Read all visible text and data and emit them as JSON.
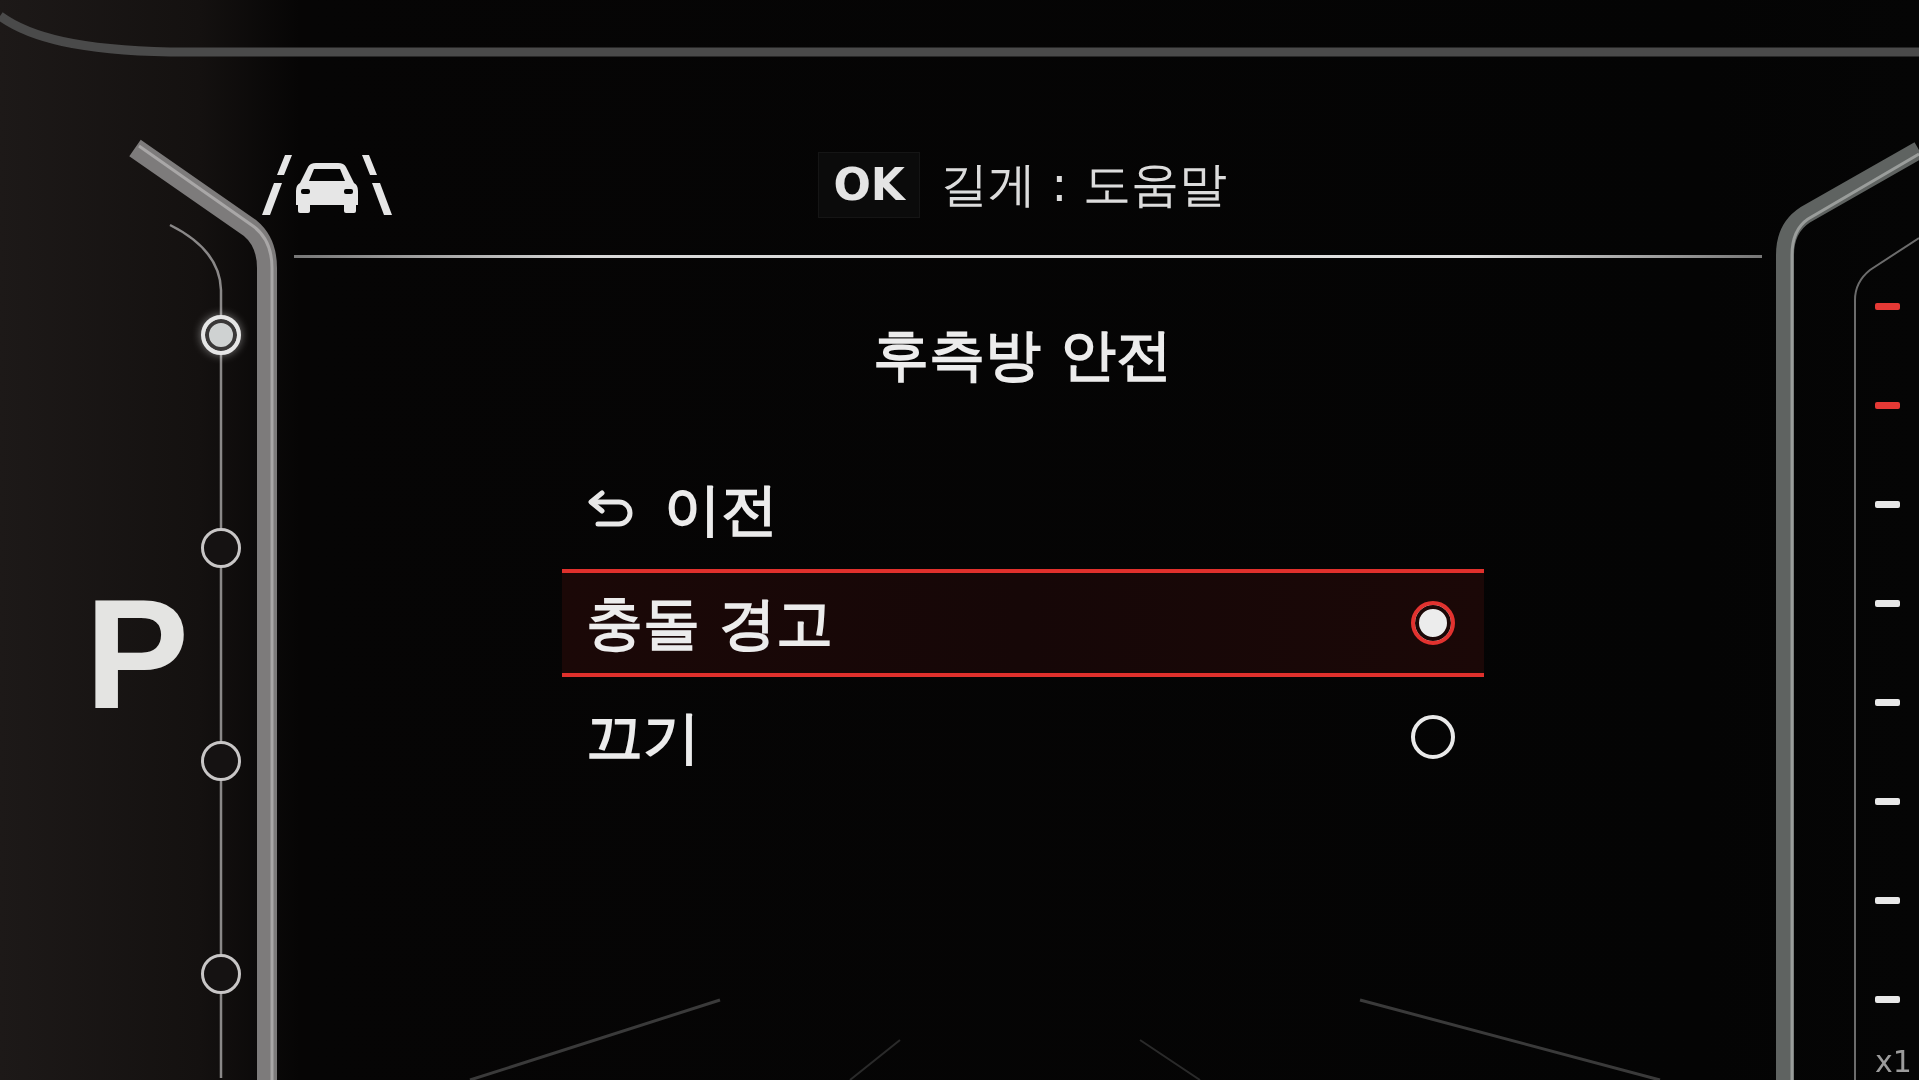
{
  "gear": {
    "label": "P",
    "positions": [
      {
        "selected": true
      },
      {
        "selected": false
      },
      {
        "selected": false
      },
      {
        "selected": false
      }
    ]
  },
  "header": {
    "key": "OK",
    "hint": "길게 : 도움말"
  },
  "title": "후측방 안전",
  "menu": {
    "items": [
      {
        "kind": "back",
        "label": "이전",
        "selected": false
      },
      {
        "kind": "option",
        "label": "충돌 경고",
        "selected": true,
        "checked": true
      },
      {
        "kind": "option",
        "label": "끄기",
        "selected": false,
        "checked": false
      }
    ]
  },
  "tachometer": {
    "ticks": [
      {
        "color": "#e53935"
      },
      {
        "color": "#e53935"
      },
      {
        "color": "#e8e8e8"
      },
      {
        "color": "#e8e8e8"
      },
      {
        "color": "#e8e8e8"
      },
      {
        "color": "#e8e8e8"
      },
      {
        "color": "#e8e8e8"
      },
      {
        "color": "#e8e8e8"
      }
    ],
    "unit": "x1"
  }
}
